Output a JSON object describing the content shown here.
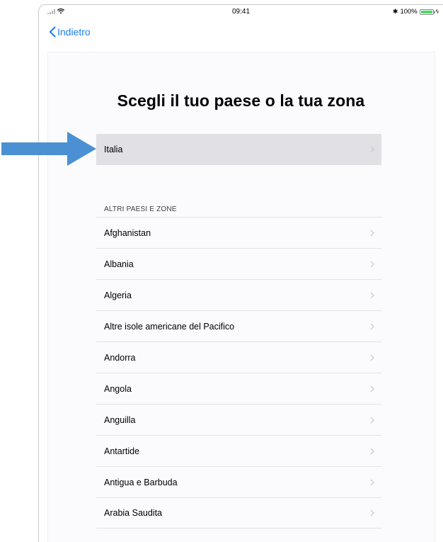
{
  "status_bar": {
    "time": "09:41",
    "battery": "100%"
  },
  "nav": {
    "back_label": "Indietro"
  },
  "page": {
    "title": "Scegli il tuo paese o la tua zona"
  },
  "selected_country": {
    "label": "Italia"
  },
  "other_section": {
    "header": "ALTRI PAESI E ZONE",
    "countries": [
      "Afghanistan",
      "Albania",
      "Algeria",
      "Altre isole americane del Pacifico",
      "Andorra",
      "Angola",
      "Anguilla",
      "Antartide",
      "Antigua e Barbuda",
      "Arabia Saudita"
    ]
  },
  "colors": {
    "accent": "#1a7cf2",
    "selected_row_bg": "#e0e0e5",
    "arrow": "#4a90d2"
  }
}
